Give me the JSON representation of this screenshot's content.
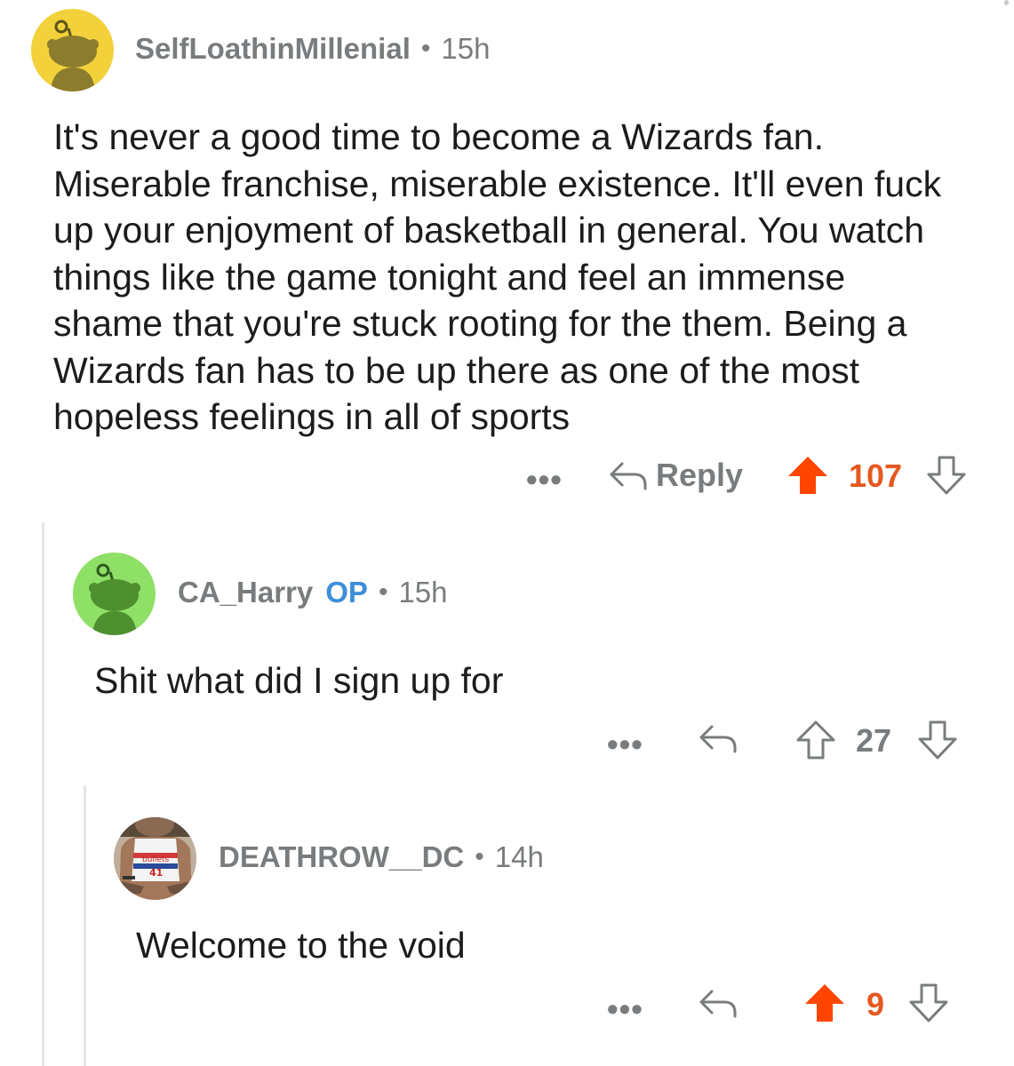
{
  "colors": {
    "upvote_active": "#ff4500",
    "score_active": "#e5581f",
    "muted": "#787c7e",
    "op_badge": "#3d8ed9",
    "text": "#1c1c1c"
  },
  "comments": [
    {
      "username": "SelfLoathinMillenial",
      "separator": "•",
      "age": "15h",
      "avatar_icon": "snoo-avatar-yellow",
      "text": "It's never a good time to become a Wizards fan. Miserable franchise, miserable existence. It'll even fuck up your enjoyment of basketball in general. You watch things like the game tonight and feel an immense shame that you're stuck rooting for the them. Being a Wizards fan has to be up there as one of the most hopeless feelings in all of sports",
      "more_label": "•••",
      "reply_label": "Reply",
      "score": "107",
      "upvoted": true
    },
    {
      "username": "CA_Harry",
      "op_badge": "OP",
      "separator": "•",
      "age": "15h",
      "avatar_icon": "snoo-avatar-green",
      "text": "Shit what did I sign up for",
      "more_label": "•••",
      "score": "27",
      "upvoted": false
    },
    {
      "username": "DEATHROW__DC",
      "separator": "•",
      "age": "14h",
      "avatar_icon": "photo-avatar",
      "avatar_jersey_text": "bullets",
      "avatar_jersey_number": "41",
      "text": "Welcome to the void",
      "more_label": "•••",
      "score": "9",
      "upvoted": true
    }
  ]
}
